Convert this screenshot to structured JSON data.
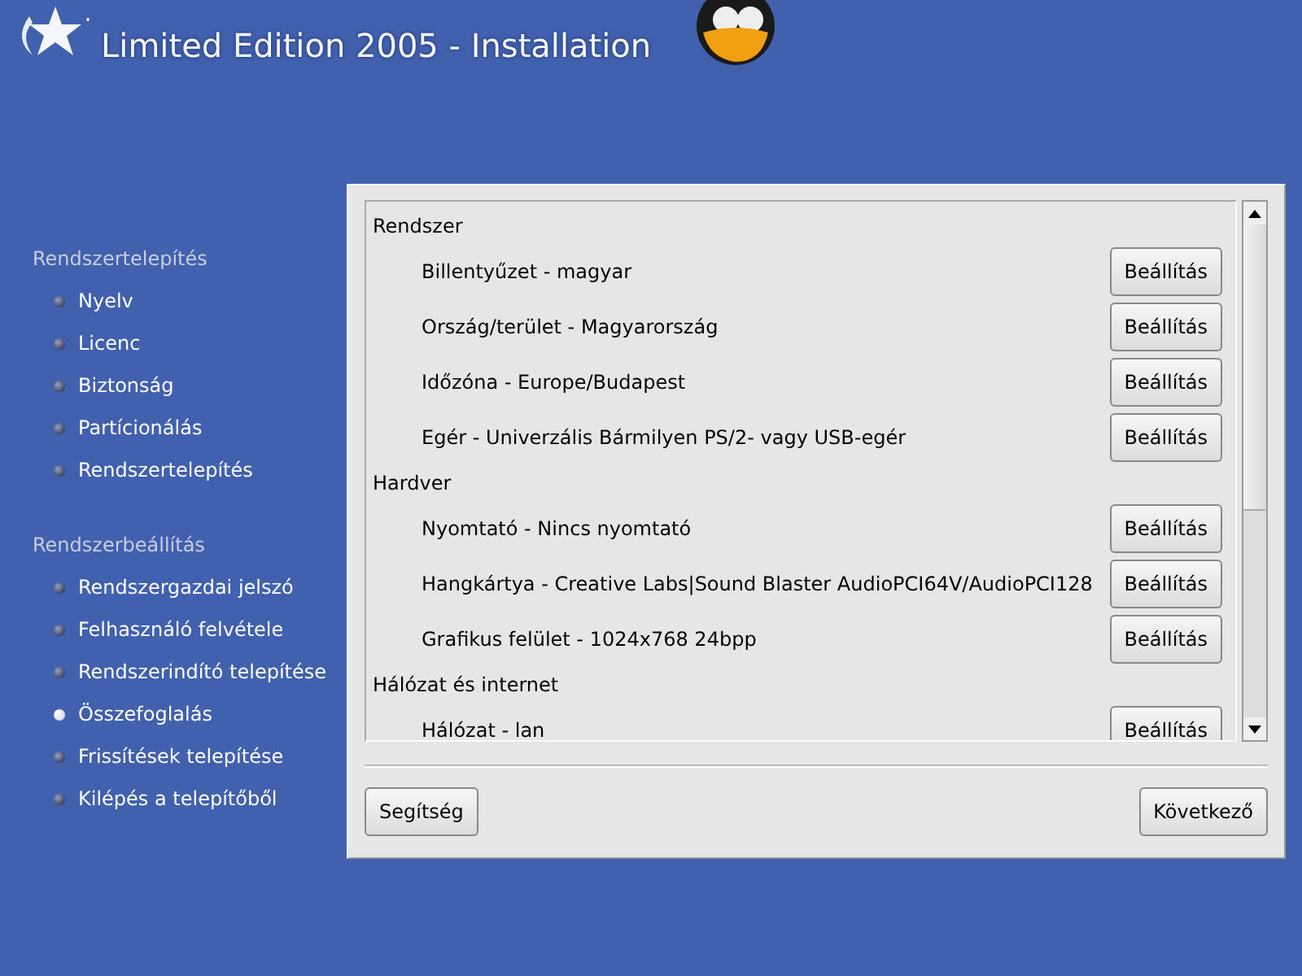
{
  "header": {
    "title": "Limited Edition 2005 - Installation"
  },
  "sidebar": {
    "sections": [
      {
        "title": "Rendszertelepítés",
        "items": [
          {
            "label": "Nyelv",
            "selected": false
          },
          {
            "label": "Licenc",
            "selected": false
          },
          {
            "label": "Biztonság",
            "selected": false
          },
          {
            "label": "Partícionálás",
            "selected": false
          },
          {
            "label": "Rendszertelepítés",
            "selected": false
          }
        ]
      },
      {
        "title": "Rendszerbeállítás",
        "items": [
          {
            "label": "Rendszergazdai jelszó",
            "selected": false
          },
          {
            "label": "Felhasználó felvétele",
            "selected": false
          },
          {
            "label": "Rendszerindító telepítése",
            "selected": false
          },
          {
            "label": "Összefoglalás",
            "selected": true
          },
          {
            "label": "Frissítések telepítése",
            "selected": false
          },
          {
            "label": "Kilépés a telepítőből",
            "selected": false
          }
        ]
      }
    ]
  },
  "summary": {
    "groups": [
      {
        "title": "Rendszer",
        "items": [
          {
            "label": "Billentyűzet - magyar",
            "button": "Beállítás"
          },
          {
            "label": "Ország/terület - Magyarország",
            "button": "Beállítás"
          },
          {
            "label": "Időzóna - Europe/Budapest",
            "button": "Beállítás"
          },
          {
            "label": "Egér - Univerzális Bármilyen PS/2- vagy USB-egér",
            "button": "Beállítás"
          }
        ]
      },
      {
        "title": "Hardver",
        "items": [
          {
            "label": "Nyomtató - Nincs nyomtató",
            "button": "Beállítás"
          },
          {
            "label": "Hangkártya - Creative Labs|Sound Blaster AudioPCI64V/AudioPCI128",
            "button": "Beállítás"
          },
          {
            "label": "Grafikus felület - 1024x768 24bpp",
            "button": "Beállítás"
          }
        ]
      },
      {
        "title": "Hálózat és internet",
        "items": [
          {
            "label": "Hálózat - lan",
            "button": "Beállítás"
          }
        ]
      }
    ]
  },
  "buttons": {
    "help": "Segítség",
    "next": "Következő"
  }
}
